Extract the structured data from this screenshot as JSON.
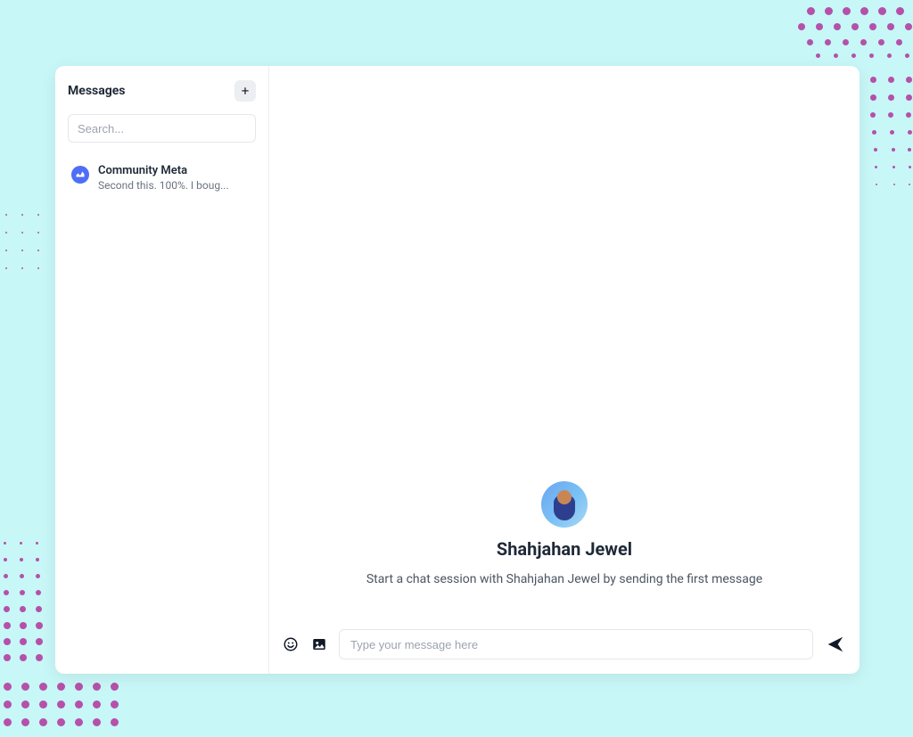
{
  "sidebar": {
    "title": "Messages",
    "add_label": "+",
    "search_placeholder": "Search...",
    "conversations": [
      {
        "name": "Community Meta",
        "preview": "Second this. 100%. I boug..."
      }
    ]
  },
  "chat": {
    "peer_name": "Shahjahan Jewel",
    "hint": "Start a chat session with Shahjahan Jewel by sending the first message"
  },
  "composer": {
    "placeholder": "Type your message here"
  }
}
